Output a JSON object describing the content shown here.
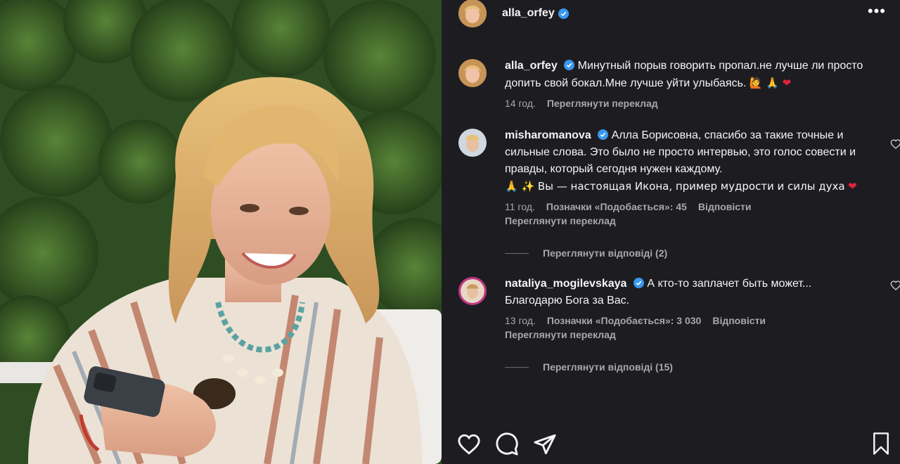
{
  "post": {
    "author": "alla_orfey",
    "more_icon": "more-horizontal-icon"
  },
  "caption": {
    "username": "alla_orfey",
    "text": "Минутный порыв говорить пропал.не лучше ли просто допить свой бокал.Мне лучше уйти улыбаясь.",
    "emojis": "🙋 🙏 ❤",
    "time": "14 год.",
    "translate": "Переглянути переклад"
  },
  "comments": [
    {
      "username": "misharomanova",
      "text": "Алла Борисовна, спасибо за такие точные и сильные слова. Это было не просто интервью, это голос совести и правды, который сегодня нужен каждому.",
      "text2": "🙏 ✨ Вы — настоящая Икона, пример мудрости и силы духа",
      "emoji_end": "❤",
      "time": "11 год.",
      "likes": "Позначки «Подобається»: 45",
      "reply": "Відповісти",
      "translate": "Переглянути переклад",
      "view_replies": "Переглянути відповіді (2)"
    },
    {
      "username": "nataliya_mogilevskaya",
      "text": "А кто-то заплачет быть может... Благодарю Бога за Вас.",
      "time": "13 год.",
      "likes": "Позначки «Подобається»: 3 030",
      "reply": "Відповісти",
      "translate": "Переглянути переклад",
      "view_replies": "Переглянути відповіді (15)"
    }
  ],
  "colors": {
    "panel_bg": "#1d1d21",
    "verified": "#3897f0",
    "muted": "#a8a8a8",
    "heart_red": "#e0243b"
  },
  "icons": [
    "heart-icon",
    "comment-icon",
    "share-icon",
    "bookmark-icon",
    "verified-badge-icon"
  ]
}
